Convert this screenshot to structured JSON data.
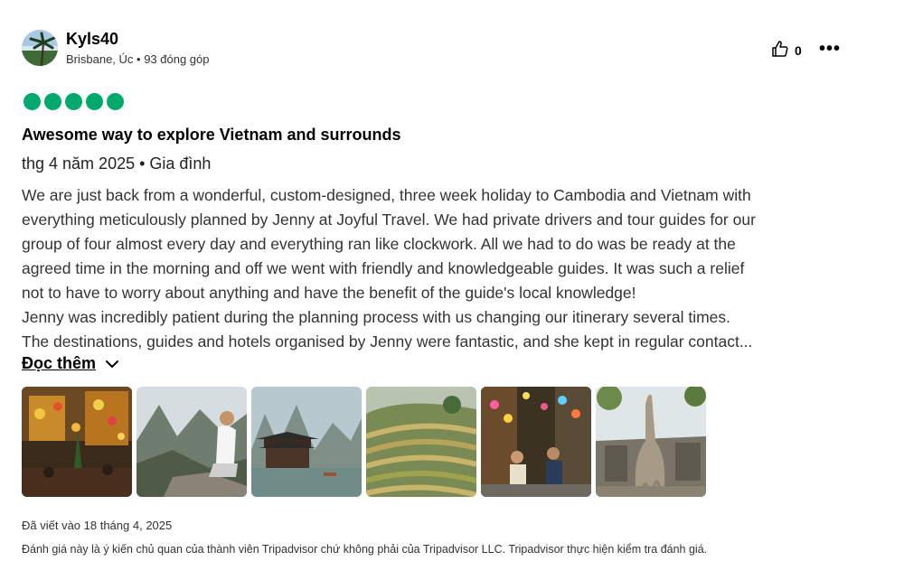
{
  "user": {
    "name": "Kyls40",
    "meta": "Brisbane, Úc • 93 đóng góp",
    "avatar_icon": "beach-palm-avatar"
  },
  "actions": {
    "like_icon": "thumbs-up-icon",
    "like_count": "0",
    "more_icon": "more-dots-icon",
    "more_label": "•••"
  },
  "review": {
    "rating": 5,
    "rating_color": "#00aa6c",
    "title": "Awesome way to explore Vietnam and surrounds",
    "trip_meta": "thg 4 năm 2025 • Gia đình",
    "body_lines": [
      "We are just back from a wonderful, custom-designed, three week holiday to Cambodia and Vietnam with",
      "everything meticulously planned by Jenny at Joyful Travel. We had private drivers and tour guides for our",
      "group of four almost every day and everything ran like clockwork. All we had to do was be ready at the",
      "agreed time in the morning and off we went with friendly and knowledgeable guides. It was such a relief",
      "not to have to worry about anything and have the benefit of the guide's local knowledge!",
      "Jenny was incredibly patient during the planning process with us changing our itinerary several times.",
      "The destinations, guides and hotels organised by Jenny were fantastic, and she kept in regular contact..."
    ],
    "read_more": "Đọc thêm",
    "read_more_icon": "chevron-down-icon"
  },
  "photos": [
    {
      "name": "lantern-street-night"
    },
    {
      "name": "woman-on-mountain-rock"
    },
    {
      "name": "pagoda-on-river"
    },
    {
      "name": "rice-terraces"
    },
    {
      "name": "friends-at-night-market"
    },
    {
      "name": "temple-ruins-tree"
    }
  ],
  "footer": {
    "written": "Đã viết vào 18 tháng 4, 2025",
    "disclaimer": "Đánh giá này là ý kiến chủ quan của thành viên Tripadvisor chứ không phải của Tripadvisor LLC. Tripadvisor thực hiện kiểm tra đánh giá."
  }
}
